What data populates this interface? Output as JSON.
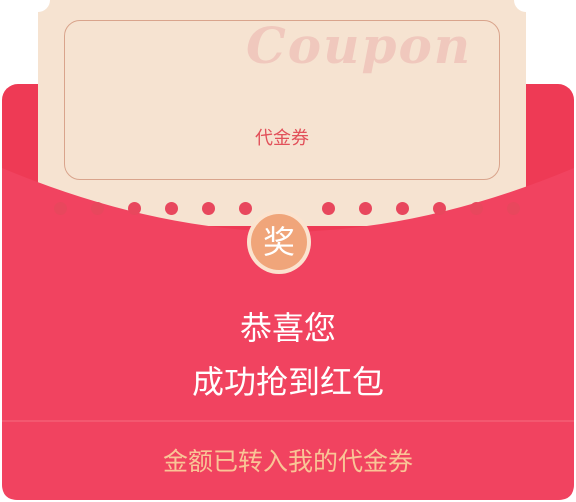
{
  "coupon": {
    "watermark": "Coupon",
    "title": "代金券"
  },
  "badge": {
    "label": "奖",
    "icon": "award-badge-icon"
  },
  "headline": {
    "line1": "恭喜您",
    "line2": "成功抢到红包"
  },
  "footer": {
    "message": "金额已转入我的代金券"
  },
  "colors": {
    "packet": "#ee3a55",
    "packet_flap": "#f14360",
    "coupon_paper": "#f6e3d1",
    "coupon_text": "#e2515a",
    "badge": "#f0a57a",
    "footer_text": "#f9c596"
  }
}
